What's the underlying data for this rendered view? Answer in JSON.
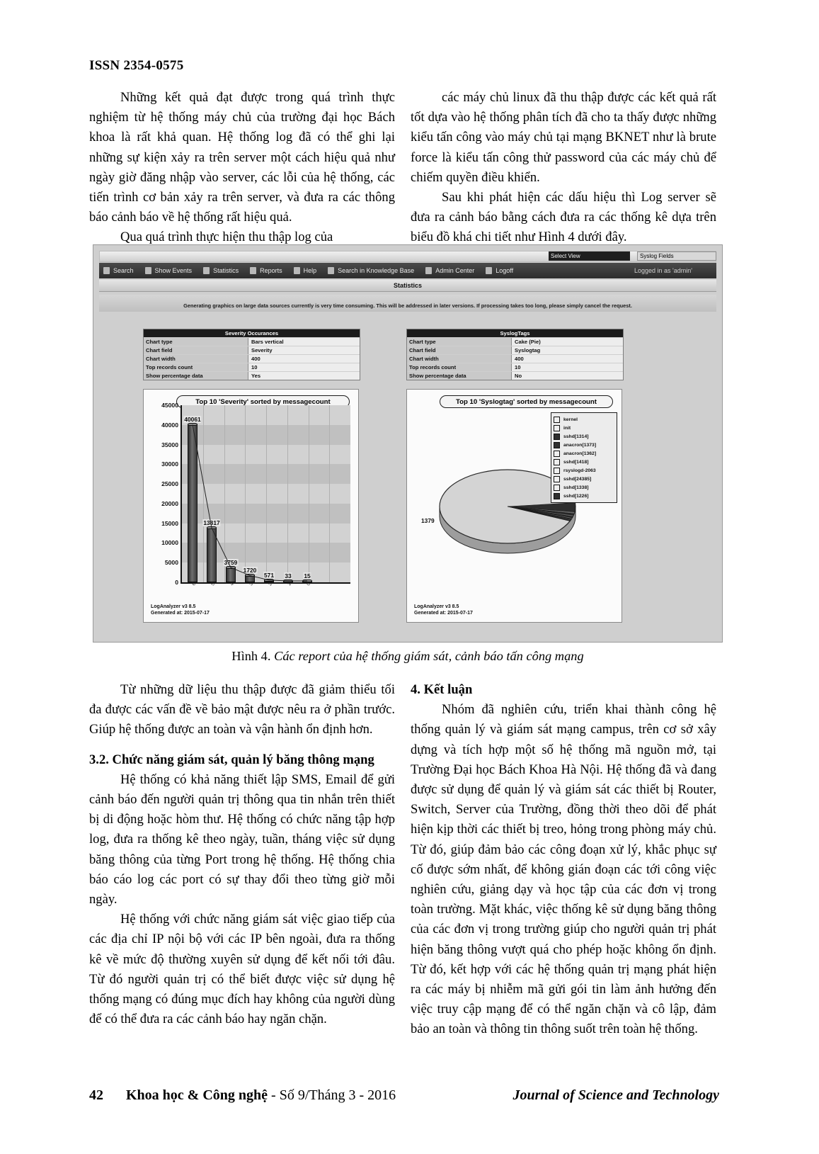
{
  "issn": "ISSN 2354-0575",
  "body": {
    "left_paragraphs": [
      "Những kết quả đạt được trong quá trình thực nghiệm từ hệ thống máy chủ của trường đại học Bách khoa là rất khả quan. Hệ thống log đã có thể ghi lại những sự kiện xảy ra trên server một cách hiệu quả như ngày giờ đăng nhập vào server, các lỗi của hệ thống, các tiến trình cơ bản xảy ra trên server, và đưa ra các thông báo cảnh báo về hệ thống rất hiệu quả.",
      "Qua quá trình thực hiện thu thập log của"
    ],
    "right_paragraphs": [
      "các máy chủ linux đã thu thập được các kết quả rất tốt dựa vào hệ thống phân tích đã cho ta thấy được những kiểu tấn công vào máy chủ tại mạng BKNET như là brute force là kiểu tấn công thử password của các máy chủ để chiếm quyền điều khiển.",
      "Sau khi phát hiện các dấu hiệu thì Log server sẽ đưa ra cảnh báo bằng cách đưa ra các thống kê dựa trên biểu đồ khá chi tiết như Hình 4 dưới đây."
    ],
    "below_left_paragraphs": [
      "Từ những dữ liệu thu thập được đã giảm thiểu tối đa được các vấn đề về bảo mật được nêu ra ở phần trước. Giúp hệ thống được an toàn và vận hành ổn định hơn."
    ],
    "section_32_heading": "3.2. Chức năng giám sát, quản lý băng thông mạng",
    "section_32_paragraphs": [
      "Hệ thống có khả năng thiết lập SMS, Email để gửi cảnh báo đến người quản trị thông qua tin nhắn trên thiết bị di động hoặc hòm thư. Hệ thống có chức năng tập hợp log, đưa ra thống kê theo ngày, tuần, tháng việc sử dụng băng thông của từng Port trong hệ thống. Hệ thống chia báo cáo log các port có sự thay đổi theo từng giờ mỗi ngày.",
      "Hệ thống với chức năng giám sát việc giao tiếp của các địa chỉ IP nội bộ với các IP bên ngoài, đưa ra thống kê về mức độ thường xuyên sử dụng để kết nối tới đâu. Từ đó người quản trị có thể biết được việc sử dụng hệ thống mạng có đúng mục đích hay không của người dùng để có thể đưa ra các cảnh báo hay ngăn chặn."
    ],
    "section_4_heading": "4. Kết luận",
    "section_4_paragraphs": [
      "Nhóm đã nghiên cứu, triển khai thành công hệ thống quản lý và giám sát mạng campus, trên cơ sở xây dựng và tích hợp một số hệ thống mã nguồn mở, tại Trường Đại học Bách Khoa Hà Nội. Hệ thống đã và đang được sử dụng để quản lý và giám sát các thiết bị Router, Switch, Server của Trường, đồng thời theo dõi để phát hiện kịp thời các thiết bị treo, hỏng trong phòng máy chủ. Từ đó, giúp đảm bảo các công đoạn xử lý, khắc phục sự cố được sớm nhất, để không gián đoạn các tới công việc nghiên cứu, giảng dạy và học tập của các đơn vị trong toàn trường. Mặt khác, việc thống kê sử dụng băng thông của các đơn vị trong trường giúp cho người quản trị phát hiện băng thông vượt quá cho phép hoặc không ổn định. Từ đó, kết hợp với các hệ thống quản trị mạng phát hiện ra các máy bị nhiễm mã gửi gói tin làm ảnh hưởng đến việc truy cập mạng để có thể ngăn chặn và cô lập, đảm bảo an toàn và thông tin thông suốt trên toàn hệ thống."
    ]
  },
  "figure": {
    "caption_label": "Hình 4.",
    "caption_text": "Các report của hệ thống giám sát, cảnh báo tấn công mạng",
    "app": {
      "select_view_label": "Select View",
      "syslog_fields_label": "Syslog Fields",
      "menu_items": [
        "Search",
        "Show Events",
        "Statistics",
        "Reports",
        "Help",
        "Search in Knowledge Base",
        "Admin Center",
        "Logoff"
      ],
      "logged_in": "Logged in as 'admin'",
      "page_title": "Statistics",
      "notice": "Generating graphics on large data sources currently is very time consuming. This will be addressed in later versions. If processing takes too long, please simply cancel the request."
    },
    "left_panel": {
      "settings_title": "Severity Occurances",
      "settings_rows": [
        {
          "key": "Chart type",
          "value": "Bars vertical"
        },
        {
          "key": "Chart field",
          "value": "Severity"
        },
        {
          "key": "Chart width",
          "value": "400"
        },
        {
          "key": "Top records count",
          "value": "10"
        },
        {
          "key": "Show percentage data",
          "value": "Yes"
        }
      ],
      "footer_line1": "LogAnalyzer v3 8.5",
      "footer_line2": "Generated at: 2015-07-17"
    },
    "right_panel": {
      "settings_title": "SyslogTags",
      "settings_rows": [
        {
          "key": "Chart type",
          "value": "Cake (Pie)"
        },
        {
          "key": "Chart field",
          "value": "Syslogtag"
        },
        {
          "key": "Chart width",
          "value": "400"
        },
        {
          "key": "Top records count",
          "value": "10"
        },
        {
          "key": "Show percentage data",
          "value": "No"
        }
      ],
      "footer_line1": "LogAnalyzer v3 8.5",
      "footer_line2": "Generated at: 2015-07-17"
    }
  },
  "chart_data": [
    {
      "type": "bar",
      "title": "Top 10 'Severity' sorted by messagecount",
      "xlabel": "",
      "ylabel": "",
      "ylim": [
        0,
        45000
      ],
      "yticks": [
        0,
        5000,
        10000,
        15000,
        20000,
        25000,
        30000,
        35000,
        40000,
        45000
      ],
      "grid": true,
      "categories": [
        "6",
        "5",
        "4",
        "3",
        "2",
        "1",
        "0"
      ],
      "values": [
        40061,
        13817,
        3759,
        1720,
        571,
        33,
        15
      ],
      "value_labels": [
        "40061",
        "13817",
        "3759",
        "1720",
        "571",
        "33",
        "15"
      ],
      "legend": "none"
    },
    {
      "type": "pie",
      "title": "Top 10 'Syslogtag' sorted by messagecount",
      "legend_position": "right",
      "labels": [
        "kernel",
        "init",
        "sshd[1314]",
        "anacron[1373]",
        "anacron[1362]",
        "sshd[1418]",
        "rsyslogd-2063",
        "sshd[24385]",
        "sshd[1338]",
        "sshd[1226]"
      ],
      "values": [
        1379,
        60,
        12,
        10,
        9,
        8,
        7,
        6,
        5,
        4
      ],
      "annotations": [
        "1379"
      ]
    }
  ],
  "footer": {
    "page_number": "42",
    "journal_vi": "Khoa học & Công nghệ",
    "issue_vi": "- Số 9/Tháng 3 - 2016",
    "journal_en": "Journal of Science and Technology"
  }
}
